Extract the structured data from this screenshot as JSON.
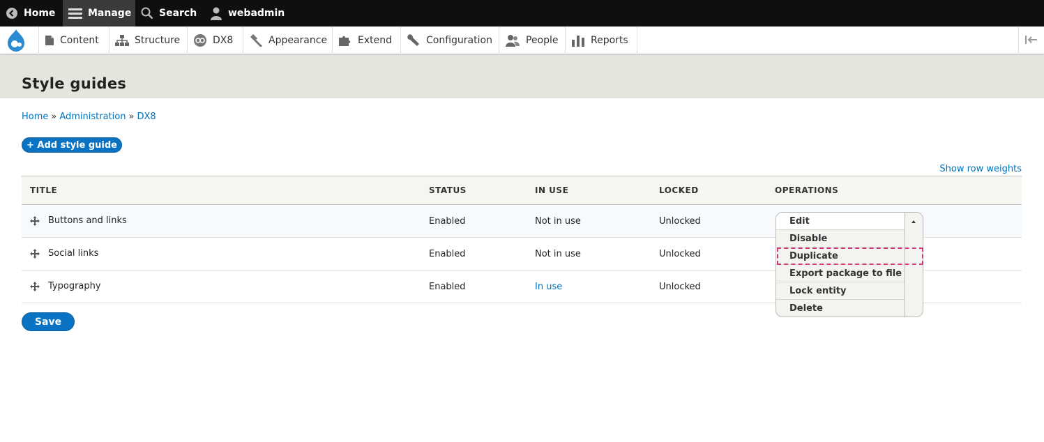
{
  "toolbar": {
    "home_label": "Home",
    "manage_label": "Manage",
    "search_label": "Search",
    "user_label": "webadmin"
  },
  "tray": {
    "items": [
      {
        "label": "Content",
        "icon": "page-icon"
      },
      {
        "label": "Structure",
        "icon": "sitemap-icon"
      },
      {
        "label": "DX8",
        "icon": "dx8-icon"
      },
      {
        "label": "Appearance",
        "icon": "brush-icon"
      },
      {
        "label": "Extend",
        "icon": "puzzle-icon"
      },
      {
        "label": "Configuration",
        "icon": "wrench-icon"
      },
      {
        "label": "People",
        "icon": "people-icon"
      },
      {
        "label": "Reports",
        "icon": "bar-chart-icon"
      }
    ]
  },
  "page": {
    "title": "Style guides"
  },
  "breadcrumb": {
    "items": [
      "Home",
      "Administration",
      "DX8"
    ],
    "separator": "»"
  },
  "actions": {
    "add_label": "+ Add style guide",
    "show_row_weights": "Show row weights",
    "save_label": "Save"
  },
  "table": {
    "headers": [
      "TITLE",
      "STATUS",
      "IN USE",
      "LOCKED",
      "OPERATIONS"
    ],
    "rows": [
      {
        "title": "Buttons and links",
        "status": "Enabled",
        "in_use": "Not in use",
        "locked": "Unlocked"
      },
      {
        "title": "Social links",
        "status": "Enabled",
        "in_use": "Not in use",
        "locked": "Unlocked"
      },
      {
        "title": "Typography",
        "status": "Enabled",
        "in_use": "In use",
        "locked": "Unlocked"
      }
    ]
  },
  "operations": {
    "items": [
      "Edit",
      "Disable",
      "Duplicate",
      "Export package to file",
      "Lock entity",
      "Delete"
    ],
    "highlighted": "Duplicate"
  },
  "colors": {
    "link": "#0074bd",
    "primary_button": "#0a72c2",
    "highlight_border": "#d23a7a",
    "header_band": "#e5e5de"
  }
}
